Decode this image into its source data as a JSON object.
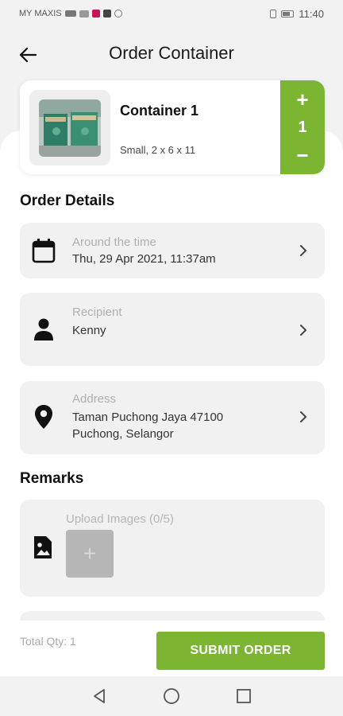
{
  "status_bar": {
    "carrier": "MY MAXIS",
    "time": "11:40"
  },
  "header": {
    "title": "Order Container",
    "back_icon": "arrow-left-icon"
  },
  "product": {
    "name": "Container 1",
    "description": "Small, 2 x 6 x 11",
    "quantity": "1",
    "plus": "+",
    "minus": "−",
    "accent": "#7cb532"
  },
  "order_details": {
    "title": "Order Details",
    "time": {
      "label": "Around the time",
      "value": "Thu, 29 Apr 2021, 11:37am",
      "icon": "calendar-icon"
    },
    "recipient": {
      "label": "Recipient",
      "value": "Kenny",
      "icon": "person-icon"
    },
    "address": {
      "label": "Address",
      "line1": "Taman Puchong Jaya  47100",
      "line2": "Puchong, Selangor",
      "icon": "location-pin-icon"
    }
  },
  "remarks": {
    "title": "Remarks",
    "upload_label": "Upload Images (0/5)",
    "upload_plus": "+",
    "icon": "image-icon"
  },
  "footer": {
    "total_qty": "Total Qty: 1",
    "submit": "SUBMIT ORDER"
  }
}
